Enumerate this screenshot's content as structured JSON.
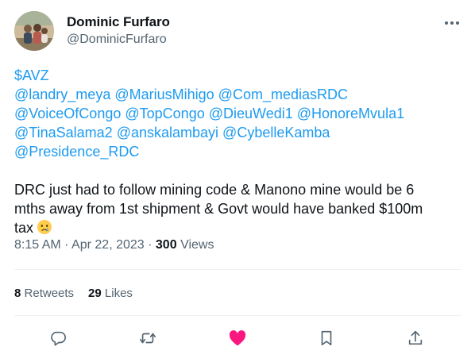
{
  "author": {
    "name": "Dominic Furfaro",
    "handle": "@DominicFurfaro"
  },
  "tweet": {
    "cashtag": "$AVZ",
    "mention_lines": [
      [
        "@landry_meya",
        "@MariusMihigo",
        "@Com_mediasRDC"
      ],
      [
        "@VoiceOfCongo",
        "@TopCongo",
        "@DieuWedi1",
        "@HonoreMvula1"
      ],
      [
        "@TinaSalama2",
        "@anskalambayi",
        "@CybelleKamba"
      ],
      [
        "@Presidence_RDC"
      ]
    ],
    "text_lines": [
      "DRC just had to follow mining code & Manono mine would be 6",
      "mths away from 1st shipment & Govt would have banked $100m",
      "tax"
    ],
    "emoji": "crying-face"
  },
  "meta": {
    "time": "8:15 AM",
    "separator": "·",
    "date": "Apr 22, 2023",
    "views_count": "300",
    "views_label": "Views"
  },
  "stats": {
    "retweets_count": "8",
    "retweets_label": "Retweets",
    "likes_count": "29",
    "likes_label": "Likes"
  },
  "actions": [
    "reply-icon",
    "retweet-icon",
    "like-icon",
    "bookmark-icon",
    "share-icon"
  ],
  "colors": {
    "link": "#1d9bf0",
    "text": "#0f1419",
    "secondary": "#536471",
    "like_active": "#f91880",
    "divider": "#eff3f4"
  }
}
